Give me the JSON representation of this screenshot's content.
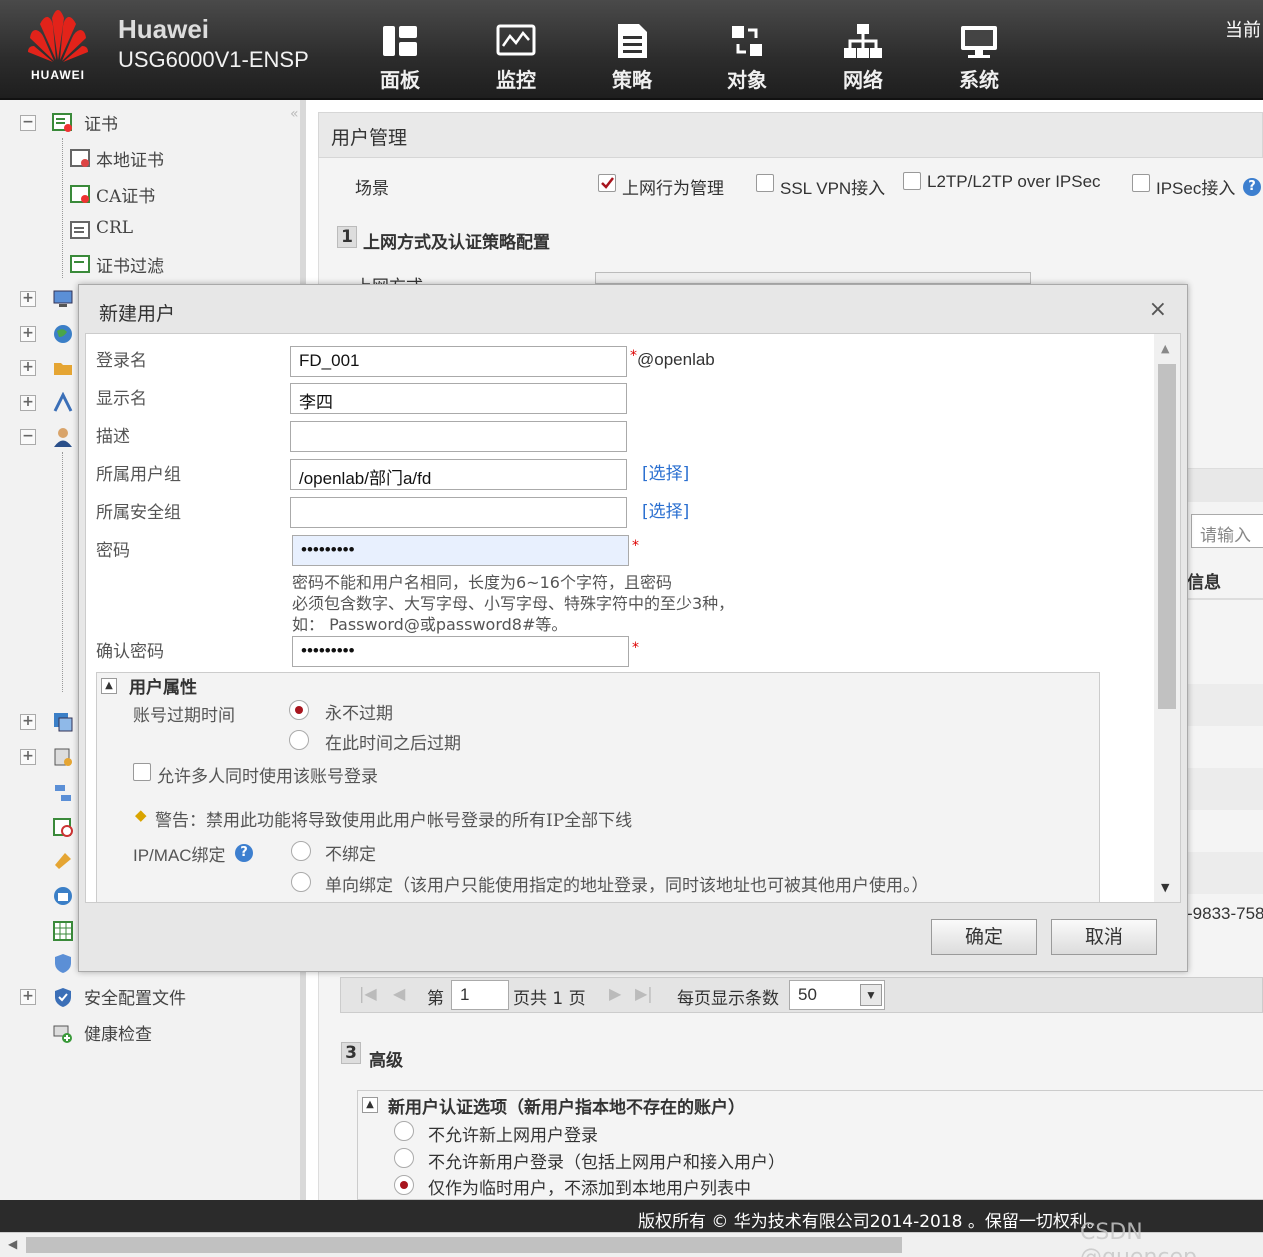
{
  "header": {
    "brand_line1": "Huawei",
    "brand_line2": "USG6000V1-ENSP",
    "logo_word": "HUAWEI",
    "current_label": "当前",
    "nav": [
      {
        "label": "面板",
        "icon": "dashboard-icon"
      },
      {
        "label": "监控",
        "icon": "monitor-icon"
      },
      {
        "label": "策略",
        "icon": "policy-icon"
      },
      {
        "label": "对象",
        "icon": "object-icon"
      },
      {
        "label": "网络",
        "icon": "network-icon"
      },
      {
        "label": "系统",
        "icon": "system-icon"
      }
    ]
  },
  "sidebar": {
    "cert_root": "证书",
    "cert_items": [
      "本地证书",
      "CA证书",
      "CRL",
      "证书过滤"
    ],
    "security_profile": "安全配置文件",
    "health_check": "健康检查"
  },
  "main": {
    "title": "用户管理",
    "scene_label": "场景",
    "scene_options": [
      {
        "label": "上网行为管理",
        "checked": true
      },
      {
        "label": "SSL VPN接入",
        "checked": false
      },
      {
        "label": "L2TP/L2TP over IPSec",
        "checked": false
      },
      {
        "label": "IPSec接入",
        "checked": false
      }
    ],
    "section1_num": "1",
    "section1_title": "上网方式及认证策略配置",
    "access_mode_label": "上网方式",
    "search_placeholder": "请输入",
    "info_col": "信息",
    "partial_value": "-9833-758",
    "pager": {
      "page_prefix": "第",
      "page_value": "1",
      "page_total": "页共 1 页",
      "per_page_label": "每页显示条数",
      "per_page_value": "50"
    },
    "section3_num": "3",
    "section3_title": "高级",
    "new_user_title": "新用户认证选项（新用户指本地不存在的账户）",
    "new_user_options": [
      {
        "label": "不允许新上网用户登录",
        "selected": false
      },
      {
        "label": "不允许新用户登录（包括上网用户和接入用户）",
        "selected": false
      },
      {
        "label": "仅作为临时用户，不添加到本地用户列表中",
        "selected": true
      }
    ]
  },
  "modal": {
    "title": "新建用户",
    "close": "×",
    "fields": {
      "login_label": "登录名",
      "login_value": "FD_001",
      "login_suffix": "@openlab",
      "display_label": "显示名",
      "display_value": "李四",
      "desc_label": "描述",
      "desc_value": "",
      "group_label": "所属用户组",
      "group_value": "/openlab/部门a/fd",
      "group_select": "[选择]",
      "secgroup_label": "所属安全组",
      "secgroup_value": "",
      "secgroup_select": "[选择]",
      "pw_label": "密码",
      "pw_value": "•••••••••",
      "pw_hint1": "密码不能和用户名相同，长度为6~16个字符，且密码",
      "pw_hint2": "必须包含数字、大写字母、小写字母、特殊字符中的至少3种，",
      "pw_hint3": "如：   Password@或password8#等。",
      "confirm_label": "确认密码",
      "confirm_value": "•••••••••",
      "req_mark": "*"
    },
    "attrs": {
      "title": "用户属性",
      "expire_label": "账号过期时间",
      "expire_never": "永不过期",
      "expire_after": "在此时间之后过期",
      "multi_login": "允许多人同时使用该账号登录",
      "warning": "警告：禁用此功能将导致使用此用户帐号登录的所有IP全部下线",
      "bind_label": "IP/MAC绑定",
      "bind_none": "不绑定",
      "bind_oneway": "单向绑定（该用户只能使用指定的地址登录，同时该地址也可被其他用户使用。）"
    },
    "ok": "确定",
    "cancel": "取消"
  },
  "footer": {
    "copyright": "版权所有 © 华为技术有限公司2014-2018 。保留一切权利。",
    "watermark": "CSDN @quencep"
  }
}
